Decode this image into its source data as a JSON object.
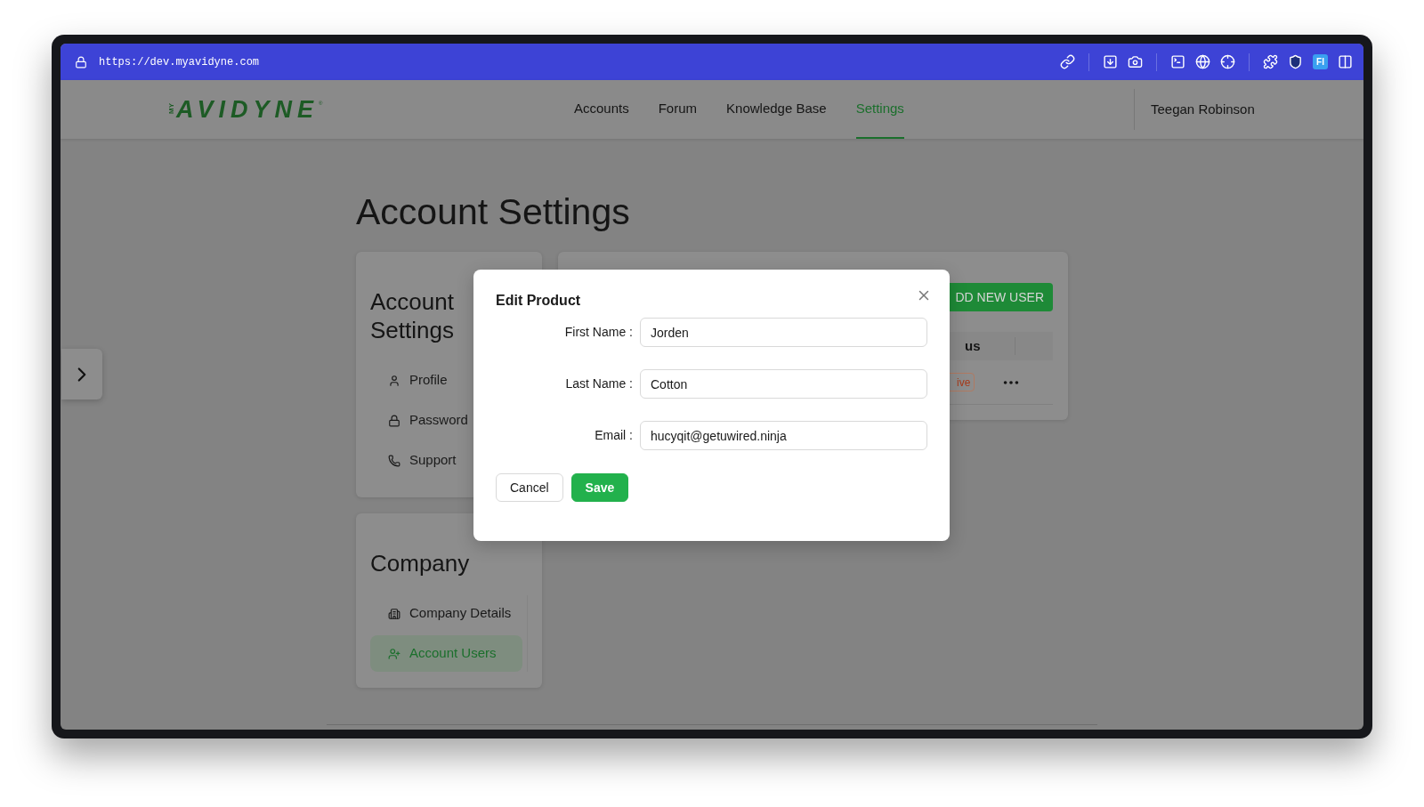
{
  "browser": {
    "url": "https://dev.myavidyne.com",
    "extension_badge": "FI"
  },
  "header": {
    "logo": {
      "prefix": "MY",
      "name": "AVIDYNE",
      "mark": "®"
    },
    "nav": [
      {
        "label": "Accounts",
        "selected": false
      },
      {
        "label": "Forum",
        "selected": false
      },
      {
        "label": "Knowledge Base",
        "selected": false
      },
      {
        "label": "Settings",
        "selected": true
      }
    ],
    "user": "Teegan Robinson"
  },
  "page_title": "Account Settings",
  "sidebar": [
    {
      "title": "Account Settings",
      "items": [
        {
          "label": "Profile",
          "kind": "user",
          "selected": false
        },
        {
          "label": "Password",
          "kind": "lock",
          "selected": false
        },
        {
          "label": "Support",
          "kind": "phone",
          "selected": false
        }
      ]
    },
    {
      "title": "Company",
      "items": [
        {
          "label": "Company Details",
          "kind": "building",
          "selected": false
        },
        {
          "label": "Account Users",
          "kind": "user-plus",
          "selected": true
        }
      ]
    }
  ],
  "users_card": {
    "add_button": "DD NEW USER",
    "column_header": "us",
    "status_badge": "ive"
  },
  "modal": {
    "title": "Edit Product",
    "fields": [
      {
        "label": "First Name :",
        "value": "Jorden"
      },
      {
        "label": "Last Name :",
        "value": "Cotton"
      },
      {
        "label": "Email :",
        "value": "hucyqit@getuwired.ninja"
      }
    ],
    "buttons": [
      {
        "label": "Cancel",
        "kind": "secondary"
      },
      {
        "label": "Save",
        "kind": "primary"
      }
    ]
  }
}
